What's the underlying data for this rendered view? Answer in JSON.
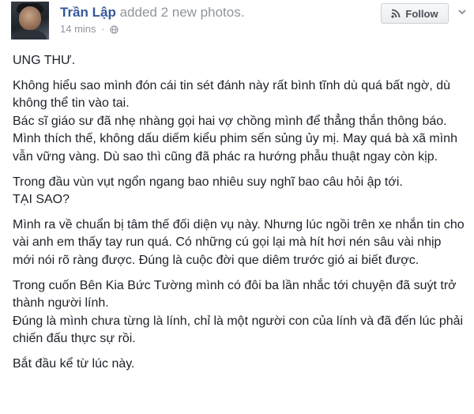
{
  "post": {
    "author": "Trần Lập",
    "action": "added 2 new photos.",
    "time": "14 mins",
    "separator": "·",
    "follow_label": "Follow",
    "icons": {
      "follow": "rss-icon",
      "privacy": "globe-icon",
      "menu": "chevron-down-icon",
      "avatar": "avatar-photo"
    },
    "colors": {
      "author": "#365899",
      "meta": "#90949c",
      "text": "#1d2129"
    }
  },
  "body": {
    "title": "UNG THƯ.",
    "p1": "Không hiểu sao mình đón cái tin sét đánh này rất bình tĩnh dù quá bất ngờ, dù không thể tin vào tai.",
    "p2": "Bác sĩ giáo sư đã nhẹ nhàng gọi hai vợ chồng mình để thẳng thắn thông báo. Mình thích thế, không dấu diếm kiểu phim sến sủng ủy mị. May quá bà xã mình vẫn vững vàng. Dù sao thì cũng đã phác ra hướng phẫu thuật ngay còn kịp.",
    "p3": "Trong đầu vùn vụt ngổn ngang bao nhiêu suy nghĩ bao câu hỏi ập tới.",
    "p4": "TẠI SAO?",
    "p5": "Mình ra về chuẩn bị tâm thế đối diện vụ này. Nhưng lúc ngồi trên xe nhắn tin cho vài anh em thấy tay run quá. Có những cú gọi lại mà hít hơi nén sâu vài nhịp mới nói rõ ràng được. Đúng là cuộc đời que diêm trước gió ai biết được.",
    "p6": "Trong cuốn Bên Kia Bức Tường mình có đôi ba lần nhắc tới chuyện đã suýt trở thành người lính.",
    "p7": "Đúng là mình chưa từng là lính, chỉ là một người con của lính và đã đến lúc phải chiến đấu thực sự rồi.",
    "p8": "Bắt đầu kể từ lúc này."
  }
}
